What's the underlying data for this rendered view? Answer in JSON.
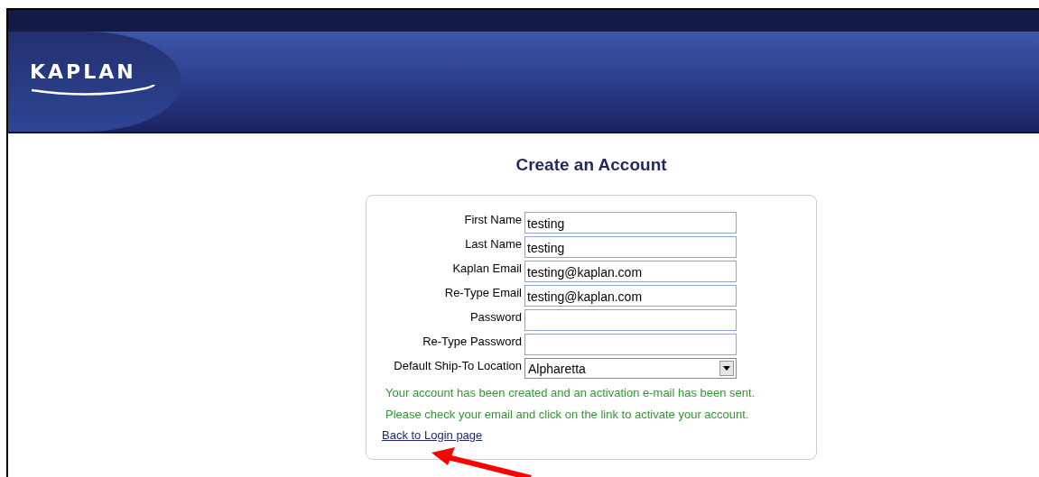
{
  "header": {
    "logo": "KAPLAN"
  },
  "title": "Create an Account",
  "form": {
    "fields": [
      {
        "kind": "text",
        "label": "First Name",
        "value": "testing"
      },
      {
        "kind": "text",
        "label": "Last Name",
        "value": "testing"
      },
      {
        "kind": "text",
        "label": "Kaplan Email",
        "value": "testing@kaplan.com"
      },
      {
        "kind": "text",
        "label": "Re-Type Email",
        "value": "testing@kaplan.com"
      },
      {
        "kind": "password",
        "label": "Password"
      },
      {
        "kind": "password",
        "label": "Re-Type Password"
      },
      {
        "kind": "select",
        "label": "Default Ship-To Location",
        "value": "Alpharetta"
      }
    ],
    "messages": [
      "Your account has been created and an activation e-mail has been sent.",
      "Please check your email and click on the link to activate your account."
    ],
    "link": "Back to Login page"
  }
}
